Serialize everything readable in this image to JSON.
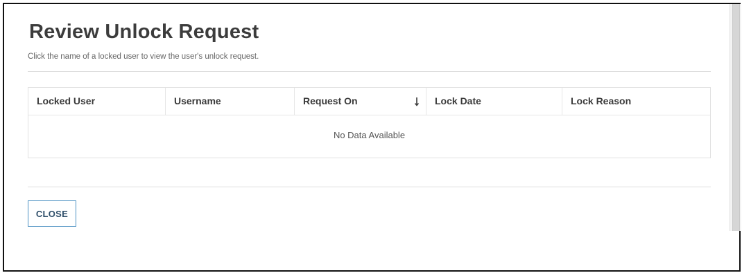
{
  "modal": {
    "title": "Review Unlock Request",
    "subtitle": "Click the name of a locked user to view the user's unlock request.",
    "close_label": "CLOSE"
  },
  "table": {
    "columns": [
      "Locked User",
      "Username",
      "Request On",
      "Lock Date",
      "Lock Reason"
    ],
    "sorted_column": "Request On",
    "sort_direction": "descending",
    "empty_message": "No Data Available",
    "rows": []
  },
  "colors": {
    "title": "#3c3c3c",
    "button_border": "#4a90c2",
    "button_text": "#2f4f6a",
    "sort_arrow": "#3a3a3a"
  },
  "icons": {
    "sort": "arrow-down-icon"
  }
}
